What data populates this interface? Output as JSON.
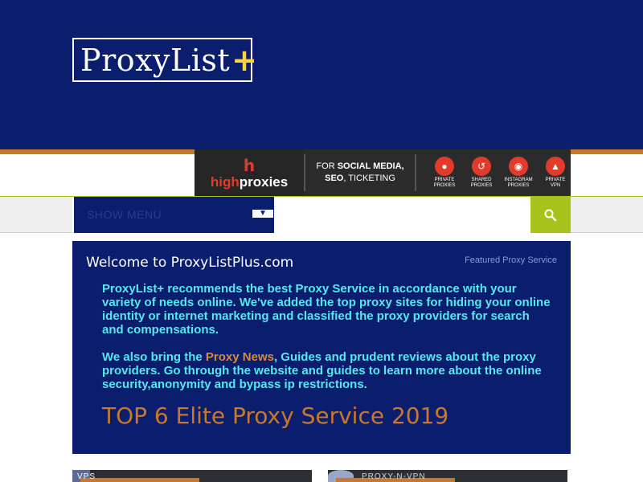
{
  "site": {
    "logo_text": "ProxyList",
    "logo_plus": "+"
  },
  "ad": {
    "brand_icon": "h",
    "brand_name_a": "high",
    "brand_name_b": "proxies",
    "tagline_prefix": "FOR ",
    "tagline_bold_1": "SOCIAL MEDIA,",
    "tagline_bold_2": "SEO",
    "tagline_suffix": ", TICKETING",
    "icons": [
      {
        "label": "Private Proxies",
        "icon": "lock-icon"
      },
      {
        "label": "Shared Proxies",
        "icon": "share-icon"
      },
      {
        "label": "Instagram Proxies",
        "icon": "camera-icon"
      },
      {
        "label": "Private VPN",
        "icon": "shield-icon"
      }
    ]
  },
  "nav": {
    "menu_label": "SHOW MENU",
    "chevron": "▼",
    "search_placeholder": ""
  },
  "content": {
    "title": "Welcome to ProxyListPlus.com",
    "featured_label": "Featured Proxy Service",
    "paragraph1": "ProxyList+ recommends the best Proxy Service in accordance with your variety of needs online. We've added the top proxy sites for hiding your online identity or internet marketing and classified the proxy providers for search and compensations.",
    "paragraph2_prefix": "We also bring the ",
    "paragraph2_link": "Proxy News",
    "paragraph2_suffix": ", Guides and prudent reviews about the proxy providers. Go through the website and guides to learn more about the online security,anonymity and bypass ip restrictions.",
    "top_heading": "TOP 6 Elite Proxy Service 2019"
  },
  "cards": [
    {
      "text": "VPS"
    },
    {
      "text": "PROXY-N-VPN"
    }
  ],
  "colors": {
    "header_bg": "#0b1e6e",
    "accent_orange": "#c8782c",
    "accent_green": "#a7c21a",
    "body_text_cyan": "#55e8ef",
    "ad_red": "#e23b2a"
  }
}
